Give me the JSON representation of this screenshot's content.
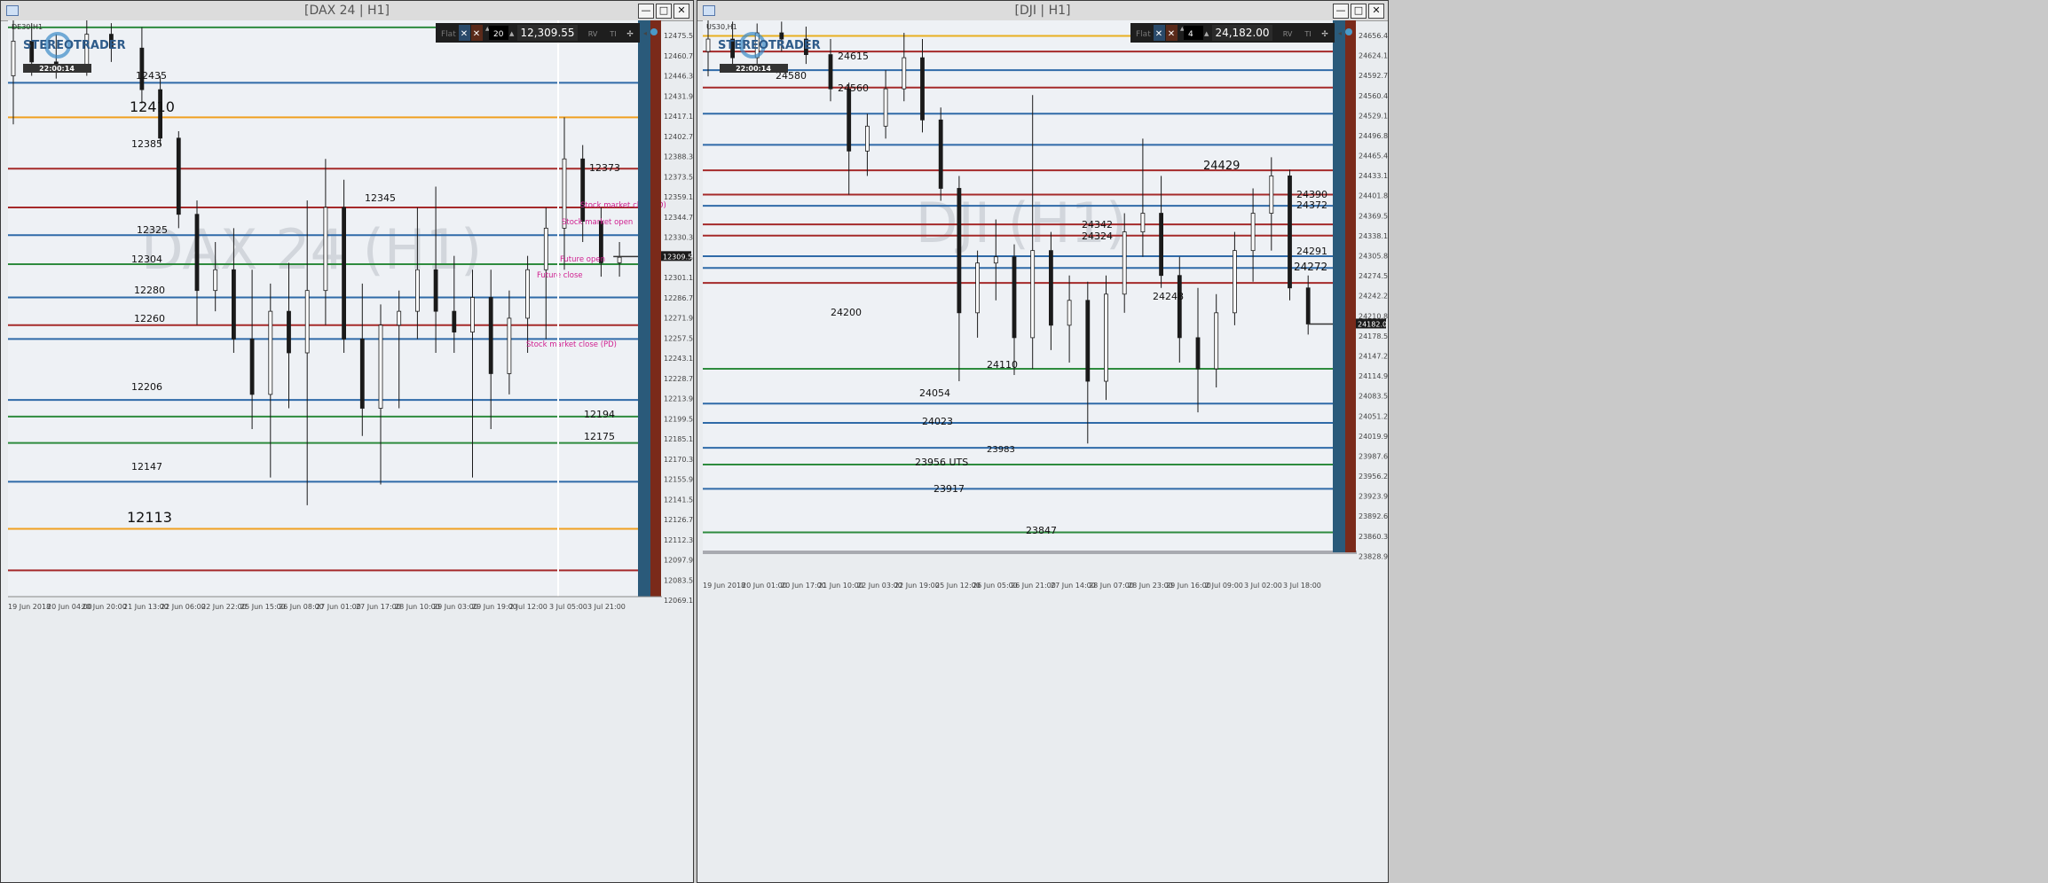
{
  "windows": [
    {
      "id": "dax",
      "title": "[DAX 24 | H1]",
      "symbol_label": "DE30,H1",
      "watermark": "DAX 24 (H1)",
      "logo": "STEREOTRADER",
      "clock": "22:00:14",
      "toolbar": {
        "mode": "Flat",
        "qty": "20",
        "price": "12,309.55",
        "btn_rv": "RV",
        "btn_ti": "TI"
      },
      "price_axis": [
        "12475.59",
        "12460.79",
        "12446.39",
        "12431.99",
        "12417.19",
        "12402.79",
        "12388.39",
        "12373.59",
        "12359.19",
        "12344.79",
        "12330.39",
        "12315.59",
        "12301.19",
        "12286.79",
        "12271.99",
        "12257.59",
        "12243.19",
        "12228.79",
        "12213.99",
        "12199.59",
        "12185.19",
        "12170.39",
        "12155.99",
        "12141.59",
        "12126.79",
        "12112.39",
        "12097.99",
        "12083.59",
        "12069.19"
      ],
      "current_price_tag": "12309.55",
      "time_axis": [
        "19 Jun 2018",
        "20 Jun 04:00",
        "20 Jun 20:00",
        "21 Jun 13:00",
        "22 Jun 06:00",
        "22 Jun 22:00",
        "25 Jun 15:00",
        "26 Jun 08:00",
        "27 Jun 01:00",
        "27 Jun 17:00",
        "28 Jun 10:00",
        "29 Jun 03:00",
        "29 Jun 19:00",
        "2 Jul 12:00",
        "3 Jul 05:00",
        "3 Jul 21:00"
      ],
      "level_labels": [
        "12435",
        "12410",
        "12385",
        "12373",
        "12345",
        "12325",
        "12304",
        "12280",
        "12260",
        "12206",
        "12194",
        "12175",
        "12147",
        "12113"
      ],
      "annotations": [
        "Stock market close (D)",
        "Stock market open",
        "Future open",
        "Future close",
        "Stock market close (PD)"
      ],
      "colors": {
        "blue": "#2f6aa8",
        "red": "#a52a2a",
        "green": "#2e8b3e",
        "orange": "#f0a020",
        "candle": "#1a1a1a"
      },
      "chart_data": {
        "type": "candlestick",
        "title": "DAX 24 | H1",
        "ylim": [
          12064,
          12480
        ],
        "x_range": [
          "19 Jun 2018",
          "3 Jul 21:00"
        ],
        "candles_approx": [
          [
            0.0,
            12440,
            12480,
            12405,
            12465
          ],
          [
            0.03,
            12465,
            12478,
            12440,
            12450
          ],
          [
            0.07,
            12450,
            12470,
            12438,
            12445
          ],
          [
            0.12,
            12445,
            12480,
            12440,
            12470
          ],
          [
            0.16,
            12470,
            12478,
            12450,
            12460
          ],
          [
            0.21,
            12460,
            12475,
            12420,
            12430
          ],
          [
            0.24,
            12430,
            12440,
            12390,
            12395
          ],
          [
            0.27,
            12395,
            12400,
            12330,
            12340
          ],
          [
            0.3,
            12340,
            12350,
            12260,
            12285
          ],
          [
            0.33,
            12285,
            12320,
            12270,
            12300
          ],
          [
            0.36,
            12300,
            12330,
            12240,
            12250
          ],
          [
            0.39,
            12250,
            12300,
            12185,
            12210
          ],
          [
            0.42,
            12210,
            12290,
            12150,
            12270
          ],
          [
            0.45,
            12270,
            12305,
            12200,
            12240
          ],
          [
            0.48,
            12240,
            12350,
            12130,
            12285
          ],
          [
            0.51,
            12285,
            12380,
            12260,
            12345
          ],
          [
            0.54,
            12345,
            12365,
            12240,
            12250
          ],
          [
            0.57,
            12250,
            12290,
            12180,
            12200
          ],
          [
            0.6,
            12200,
            12275,
            12145,
            12260
          ],
          [
            0.63,
            12260,
            12285,
            12200,
            12270
          ],
          [
            0.66,
            12270,
            12345,
            12250,
            12300
          ],
          [
            0.69,
            12300,
            12360,
            12240,
            12270
          ],
          [
            0.72,
            12270,
            12310,
            12240,
            12255
          ],
          [
            0.75,
            12255,
            12300,
            12150,
            12280
          ],
          [
            0.78,
            12280,
            12300,
            12185,
            12225
          ],
          [
            0.81,
            12225,
            12285,
            12210,
            12265
          ],
          [
            0.84,
            12265,
            12310,
            12240,
            12300
          ],
          [
            0.87,
            12300,
            12345,
            12250,
            12330
          ],
          [
            0.9,
            12330,
            12410,
            12300,
            12380
          ],
          [
            0.93,
            12380,
            12390,
            12320,
            12335
          ],
          [
            0.96,
            12335,
            12345,
            12295,
            12305
          ],
          [
            0.99,
            12305,
            12320,
            12295,
            12309
          ]
        ],
        "levels": [
          {
            "price": 12475,
            "color": "green"
          },
          {
            "price": 12435,
            "color": "blue"
          },
          {
            "price": 12410,
            "color": "orange"
          },
          {
            "price": 12373,
            "color": "red"
          },
          {
            "price": 12345,
            "color": "red"
          },
          {
            "price": 12325,
            "color": "blue"
          },
          {
            "price": 12304,
            "color": "green"
          },
          {
            "price": 12280,
            "color": "blue"
          },
          {
            "price": 12260,
            "color": "red"
          },
          {
            "price": 12250,
            "color": "blue"
          },
          {
            "price": 12206,
            "color": "blue"
          },
          {
            "price": 12194,
            "color": "green"
          },
          {
            "price": 12175,
            "color": "green"
          },
          {
            "price": 12147,
            "color": "blue"
          },
          {
            "price": 12113,
            "color": "orange"
          },
          {
            "price": 12083,
            "color": "red"
          }
        ]
      }
    },
    {
      "id": "dji",
      "title": "[DJI | H1]",
      "symbol_label": "US30,H1",
      "watermark": "DJI (H1)",
      "logo": "STEREOTRADER",
      "clock": "22:00:14",
      "toolbar": {
        "mode": "Flat",
        "qty": "4",
        "price": "24,182.00",
        "btn_rv": "RV",
        "btn_ti": "TI"
      },
      "price_axis": [
        "24656.43",
        "24624.13",
        "24592.78",
        "24560.48",
        "24529.13",
        "24496.83",
        "24465.48",
        "24433.18",
        "24401.83",
        "24369.53",
        "24338.18",
        "24305.88",
        "24274.53",
        "24242.23",
        "24210.88",
        "24178.58",
        "24147.23",
        "24114.93",
        "24083.58",
        "24051.28",
        "24019.93",
        "23987.63",
        "23956.28",
        "23923.98",
        "23892.63",
        "23860.33",
        "23828.98"
      ],
      "current_price_tag": "24182.00",
      "time_axis": [
        "19 Jun 2018",
        "20 Jun 01:00",
        "20 Jun 17:00",
        "21 Jun 10:00",
        "22 Jun 03:00",
        "22 Jun 19:00",
        "25 Jun 12:00",
        "26 Jun 05:00",
        "26 Jun 21:00",
        "27 Jun 14:00",
        "28 Jun 07:00",
        "28 Jun 23:00",
        "29 Jun 16:00",
        "2 Jul 09:00",
        "3 Jul 02:00",
        "3 Jul 18:00"
      ],
      "level_labels": [
        "24615",
        "24580",
        "24560",
        "24429",
        "24390",
        "24372",
        "24342",
        "24324",
        "24291",
        "24272",
        "24248",
        "24200",
        "24110",
        "24054",
        "24023",
        "23983",
        "23956 UTS",
        "23917",
        "23847"
      ],
      "colors": {
        "blue": "#2f6aa8",
        "red": "#a52a2a",
        "green": "#2e8b3e",
        "orange": "#e8b020",
        "candle": "#1a1a1a"
      },
      "chart_data": {
        "type": "candlestick",
        "title": "DJI | H1",
        "ylim": [
          23815,
          24670
        ],
        "x_range": [
          "19 Jun 2018",
          "3 Jul 18:00"
        ],
        "candles_approx": [
          [
            0.0,
            24620,
            24670,
            24580,
            24640
          ],
          [
            0.04,
            24640,
            24668,
            24590,
            24610
          ],
          [
            0.08,
            24610,
            24665,
            24590,
            24650
          ],
          [
            0.12,
            24650,
            24668,
            24620,
            24640
          ],
          [
            0.16,
            24640,
            24660,
            24600,
            24615
          ],
          [
            0.2,
            24615,
            24640,
            24540,
            24560
          ],
          [
            0.23,
            24560,
            24570,
            24390,
            24460
          ],
          [
            0.26,
            24460,
            24520,
            24420,
            24500
          ],
          [
            0.29,
            24500,
            24590,
            24480,
            24560
          ],
          [
            0.32,
            24560,
            24650,
            24540,
            24610
          ],
          [
            0.35,
            24610,
            24640,
            24490,
            24510
          ],
          [
            0.38,
            24510,
            24530,
            24380,
            24400
          ],
          [
            0.41,
            24400,
            24420,
            24090,
            24200
          ],
          [
            0.44,
            24200,
            24300,
            24160,
            24280
          ],
          [
            0.47,
            24280,
            24350,
            24220,
            24290
          ],
          [
            0.5,
            24290,
            24310,
            24100,
            24160
          ],
          [
            0.53,
            24160,
            24550,
            24110,
            24300
          ],
          [
            0.56,
            24300,
            24330,
            24140,
            24180
          ],
          [
            0.59,
            24180,
            24260,
            24120,
            24220
          ],
          [
            0.62,
            24220,
            24250,
            23990,
            24090
          ],
          [
            0.65,
            24090,
            24260,
            24060,
            24230
          ],
          [
            0.68,
            24230,
            24360,
            24200,
            24330
          ],
          [
            0.71,
            24330,
            24480,
            24290,
            24360
          ],
          [
            0.74,
            24360,
            24420,
            24240,
            24260
          ],
          [
            0.77,
            24260,
            24290,
            24120,
            24160
          ],
          [
            0.8,
            24160,
            24240,
            24040,
            24110
          ],
          [
            0.83,
            24110,
            24230,
            24080,
            24200
          ],
          [
            0.86,
            24200,
            24330,
            24180,
            24300
          ],
          [
            0.89,
            24300,
            24400,
            24250,
            24360
          ],
          [
            0.92,
            24360,
            24450,
            24300,
            24420
          ],
          [
            0.95,
            24420,
            24430,
            24220,
            24240
          ],
          [
            0.98,
            24240,
            24260,
            24165,
            24182
          ]
        ],
        "levels": [
          {
            "price": 24645,
            "color": "orange"
          },
          {
            "price": 24620,
            "color": "red"
          },
          {
            "price": 24590,
            "color": "blue"
          },
          {
            "price": 24562,
            "color": "red"
          },
          {
            "price": 24520,
            "color": "blue"
          },
          {
            "price": 24470,
            "color": "blue"
          },
          {
            "price": 24429,
            "color": "red"
          },
          {
            "price": 24390,
            "color": "red"
          },
          {
            "price": 24372,
            "color": "blue"
          },
          {
            "price": 24342,
            "color": "red"
          },
          {
            "price": 24324,
            "color": "red"
          },
          {
            "price": 24291,
            "color": "blue"
          },
          {
            "price": 24272,
            "color": "blue"
          },
          {
            "price": 24248,
            "color": "red"
          },
          {
            "price": 24110,
            "color": "green"
          },
          {
            "price": 24054,
            "color": "blue"
          },
          {
            "price": 24023,
            "color": "blue"
          },
          {
            "price": 23983,
            "color": "blue"
          },
          {
            "price": 23956,
            "color": "green"
          },
          {
            "price": 23917,
            "color": "blue"
          },
          {
            "price": 23847,
            "color": "green"
          }
        ]
      }
    }
  ]
}
